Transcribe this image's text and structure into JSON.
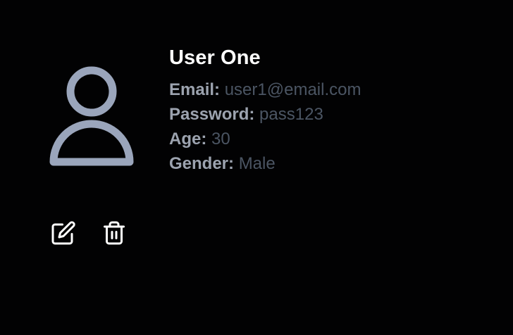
{
  "user": {
    "name": "User One",
    "fields": [
      {
        "label": "Email:",
        "value": "user1@email.com"
      },
      {
        "label": "Password:",
        "value": "pass123"
      },
      {
        "label": "Age:",
        "value": "30"
      },
      {
        "label": "Gender:",
        "value": "Male"
      }
    ]
  },
  "avatar": {
    "icon": "user-icon",
    "color": "#9aa5bb"
  },
  "actions": [
    {
      "icon": "edit-icon"
    },
    {
      "icon": "trash-icon"
    }
  ],
  "colors": {
    "background": "#020203",
    "name": "#ffffff",
    "label": "#9ca3af",
    "value": "#4b5563",
    "action_icon": "#ffffff"
  }
}
